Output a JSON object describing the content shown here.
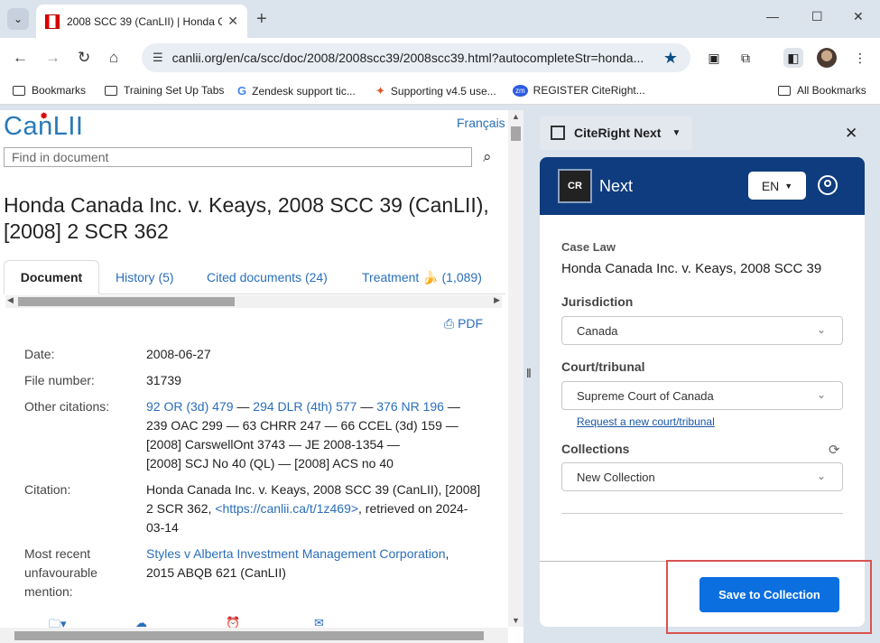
{
  "browser": {
    "tab_title": "2008 SCC 39 (CanLII) | Honda C",
    "url": "canlii.org/en/ca/scc/doc/2008/2008scc39/2008scc39.html?autocompleteStr=honda...",
    "bookmarks": [
      "Bookmarks",
      "Training Set Up Tabs",
      "Zendesk support tic...",
      "Supporting v4.5 use...",
      "REGISTER CiteRight...",
      "All Bookmarks"
    ]
  },
  "page": {
    "logo": "CanLII",
    "lang_link": "Français",
    "find_placeholder": "Find in document",
    "title": "Honda Canada Inc. v. Keays, 2008 SCC 39 (CanLII), [2008] 2 SCR 362",
    "tabs": [
      "Document",
      "History (5)",
      "Cited documents (24)",
      "Treatment 🍌 (1,089)"
    ],
    "pdf_label": "PDF",
    "fields": {
      "date_label": "Date:",
      "date": "2008-06-27",
      "file_label": "File number:",
      "file": "31739",
      "other_label": "Other citations:",
      "other_link1": "92 OR (3d) 479",
      "other_link2": "294 DLR (4th) 577",
      "other_link3": "376 NR 196",
      "other_rest1": "239 OAC 299 — 63 CHRR 247 — 66 CCEL (3d) 159 —",
      "other_rest2": "[2008] CarswellOnt 3743 — JE 2008-1354 —",
      "other_rest3": "[2008] SCJ No 40 (QL) — [2008] ACS no 40",
      "citation_label": "Citation:",
      "citation_text": "Honda Canada Inc. v. Keays, 2008 SCC 39 (CanLII), [2008] 2 SCR 362,",
      "citation_link": "<https://canlii.ca/t/1z469>",
      "citation_after": ", retrieved on 2024-03-14",
      "recent_label": "Most recent unfavourable mention:",
      "recent_link": "Styles v Alberta Investment Management Corporation",
      "recent_text": "2015 ABQB 621 (CanLII)"
    }
  },
  "panel": {
    "header_label": "CiteRight Next",
    "brand": "Next",
    "logo_text": "CR",
    "lang": "EN",
    "case_law_label": "Case Law",
    "case_name": "Honda Canada Inc. v. Keays, 2008 SCC 39",
    "jurisdiction_label": "Jurisdiction",
    "jurisdiction_value": "Canada",
    "court_label": "Court/tribunal",
    "court_value": "Supreme Court of Canada",
    "request_link": "Request a new court/tribunal",
    "collections_label": "Collections",
    "collection_value": "New Collection",
    "save_button": "Save to Collection"
  }
}
